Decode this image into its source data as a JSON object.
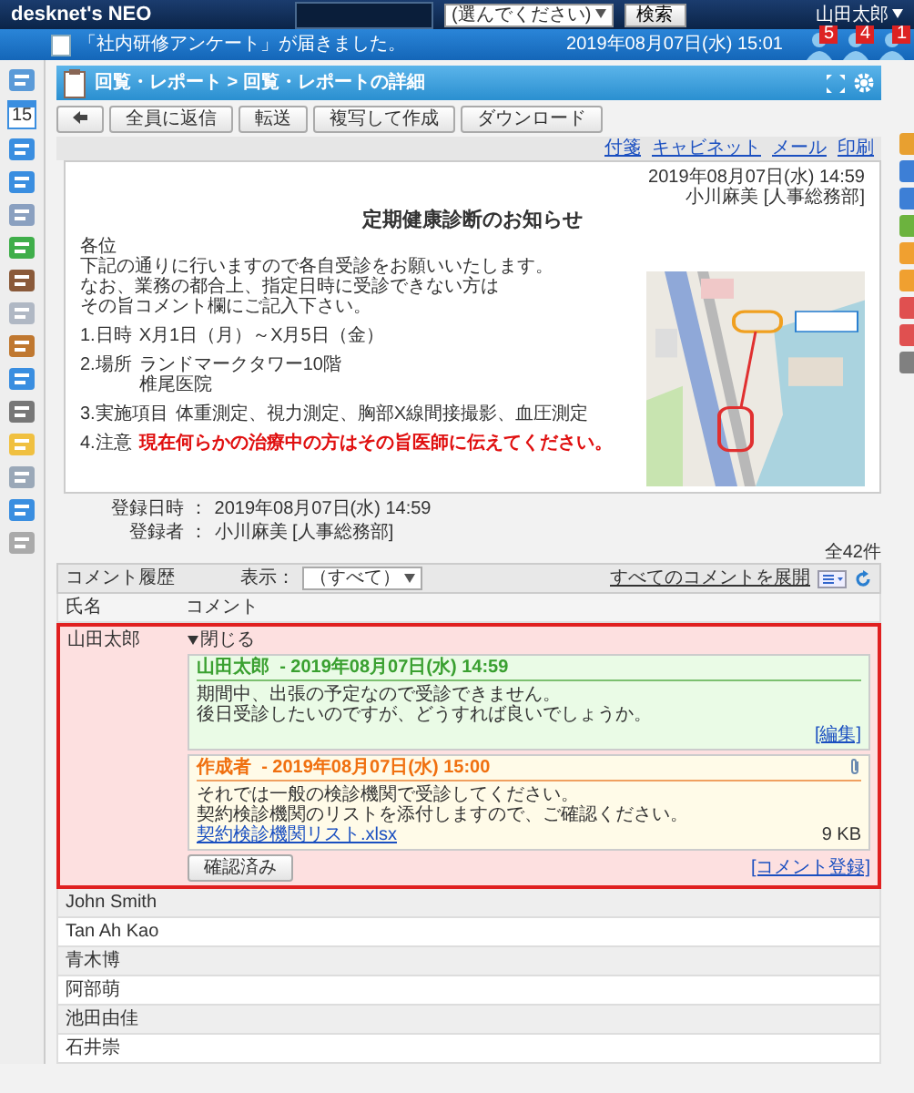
{
  "header": {
    "logo": "desknet's NEO",
    "search_select": "(選んでください)",
    "search_button": "検索",
    "user_menu": "山田太郎"
  },
  "notice": {
    "message": "「社内研修アンケート」が届きました。",
    "time": "2019年08月07日(水) 15:01",
    "badges": [
      "5",
      "4",
      "1"
    ]
  },
  "sidebar": {
    "calendar_day": "15"
  },
  "right_tabs": [
    {
      "color": "#e8a030"
    },
    {
      "color": "#3d7fd6"
    },
    {
      "color": "#3d7fd6"
    },
    {
      "color": "#6cb33e"
    },
    {
      "color": "#f0a030"
    },
    {
      "color": "#f0a030"
    },
    {
      "color": "#e05050"
    },
    {
      "color": "#e05050"
    },
    {
      "color": "#808080"
    }
  ],
  "title_bar": {
    "breadcrumb": "回覧・レポート > 回覧・レポートの詳細"
  },
  "toolbar": {
    "buttons": [
      "全員に返信",
      "転送",
      "複写して作成",
      "ダウンロード"
    ]
  },
  "links": [
    "付箋",
    "キャビネット",
    "メール",
    "印刷"
  ],
  "document": {
    "date": "2019年08月07日(水) 14:59",
    "author": "小川麻美 [人事総務部]",
    "title": "定期健康診断のお知らせ",
    "greeting": "各位",
    "intro": [
      "下記の通りに行いますので各自受診をお願いいたします。",
      "なお、業務の都合上、指定日時に受診できない方は",
      "その旨コメント欄にご記入下さい。"
    ],
    "items": [
      {
        "label": "1.日時",
        "lines": [
          "X月1日（月）～X月5日（金）"
        ],
        "warning": false
      },
      {
        "label": "2.場所",
        "lines": [
          "ランドマークタワー10階",
          "椎尾医院"
        ],
        "warning": false
      },
      {
        "label": "3.実施項目",
        "lines": [
          "体重測定、視力測定、胸部X線間接撮影、血圧測定"
        ],
        "warning": false
      },
      {
        "label": "4.注意",
        "lines": [
          "現在何らかの治療中の方はその旨医師に伝えてください。"
        ],
        "warning": true
      }
    ],
    "map": {
      "kind": "picture"
    }
  },
  "registration": [
    {
      "label": "登録日時 ：",
      "value": "2019年08月07日(水) 14:59"
    },
    {
      "label": "登録者 ：",
      "value": "小川麻美 [人事総務部]"
    }
  ],
  "total": "全42件",
  "comments": {
    "title": "コメント履歴",
    "filter_label": "表示：",
    "filter_value": "（すべて）",
    "expand_link": "すべてのコメントを展開",
    "columns": [
      "氏名",
      "コメント"
    ],
    "rows": [
      {
        "name": "山田太郎",
        "expanded": true,
        "collapse_link": "閉じる",
        "entries": [
          {
            "kind": "reply",
            "author": "山田太郎",
            "time": "- 2019年08月07日(水) 14:59",
            "lines": [
              "期間中、出張の予定なので受診できません。",
              "後日受診したいのですが、どうすれば良いでしょうか。"
            ],
            "action": "[編集]"
          },
          {
            "kind": "creator",
            "author": "作成者",
            "time": "- 2019年08月07日(水) 15:00",
            "lines": [
              "それでは一般の検診機関で受診してください。",
              "契約検診機関のリストを添付しますので、ご確認ください。"
            ],
            "attachment": "契約検診機関リスト.xlsx",
            "size": "9 KB"
          }
        ],
        "confirm_button": "確認済み",
        "register_link": "[コメント登録]"
      },
      {
        "name": "John Smith",
        "expanded": false
      },
      {
        "name": "Tan Ah Kao",
        "expanded": false
      },
      {
        "name": "青木博",
        "expanded": false
      },
      {
        "name": "阿部萌",
        "expanded": false
      },
      {
        "name": "池田由佳",
        "expanded": false
      },
      {
        "name": "石井崇",
        "expanded": false
      }
    ]
  }
}
